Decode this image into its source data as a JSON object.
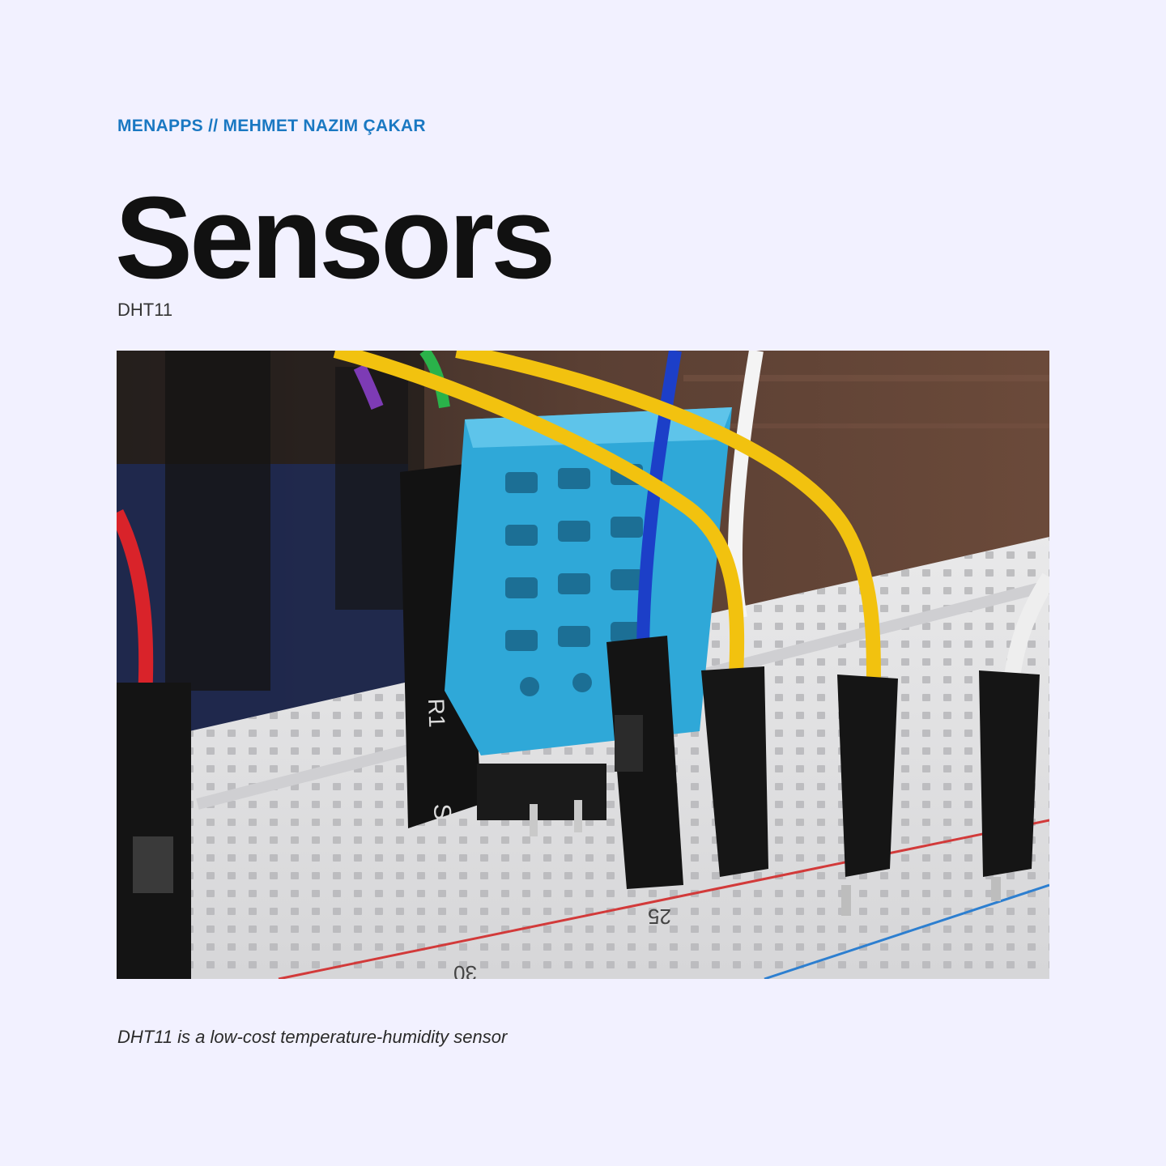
{
  "header": {
    "kicker": "MENAPPS // MEHMET NAZIM ÇAKAR",
    "title": "Sensors",
    "subtitle": "DHT11"
  },
  "photo": {
    "board_labels": [
      "R1",
      "S",
      "25",
      "30"
    ]
  },
  "caption": "DHT11 is a low-cost temperature-humidity sensor",
  "colors": {
    "background": "#f2f1ff",
    "kicker": "#1a78c2",
    "title": "#111111",
    "sensor": "#2fa8d8",
    "wire_yellow": "#f2c20f",
    "wire_blue": "#1c3fc8"
  }
}
